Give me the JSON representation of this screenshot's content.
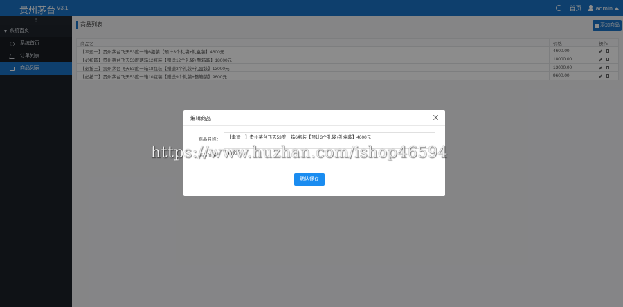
{
  "topbar": {
    "brand": "贵州茅台",
    "version": "V3.1",
    "refresh_icon": "refresh-icon",
    "home_label": "首页",
    "user_label": "admin"
  },
  "sidebar": {
    "toggle": "⁝",
    "group_label": "系统首页",
    "items": [
      {
        "label": "系统首页",
        "icon": "gear-icon"
      },
      {
        "label": "订单列表",
        "icon": "cart-icon"
      },
      {
        "label": "商品列表",
        "icon": "basket-icon"
      }
    ]
  },
  "main": {
    "title": "商品列表",
    "add_button": "添加商品",
    "table": {
      "headers": [
        "商品名",
        "价格",
        "操作"
      ],
      "rows": [
        {
          "name": "【幸运一】贵州茅台飞天53度一箱6瓶装【预计3个礼袋+礼盒装】4600元",
          "price": "4600.00"
        },
        {
          "name": "【必抢四】贵州茅台飞天53度两箱12瓶装【赠送12个礼袋+整箱装】18000元",
          "price": "18000.00"
        },
        {
          "name": "【必抢三】贵州茅台飞天53度一箱18瓶装【赠送3个礼袋+礼盒装】13000元",
          "price": "13000.00"
        },
        {
          "name": "【必抢二】贵州茅台飞天53度一箱10瓶装【赠送9个礼袋+整箱装】9600元",
          "price": "9600.00"
        }
      ]
    }
  },
  "modal": {
    "title": "编辑商品",
    "name_label": "商品名称：",
    "name_value": "【幸运一】贵州茅台飞天53度一箱6瓶装【预计3个礼袋+礼盒装】4600元",
    "price_label": "商品价格：",
    "price_value": "4600",
    "confirm_button": "确认保存"
  },
  "watermark": "https://www.huzhan.com/ishop46594",
  "colors": {
    "accent": "#1a73c7",
    "sidebar_bg": "#1c2128",
    "confirm": "#1a8cf0"
  }
}
